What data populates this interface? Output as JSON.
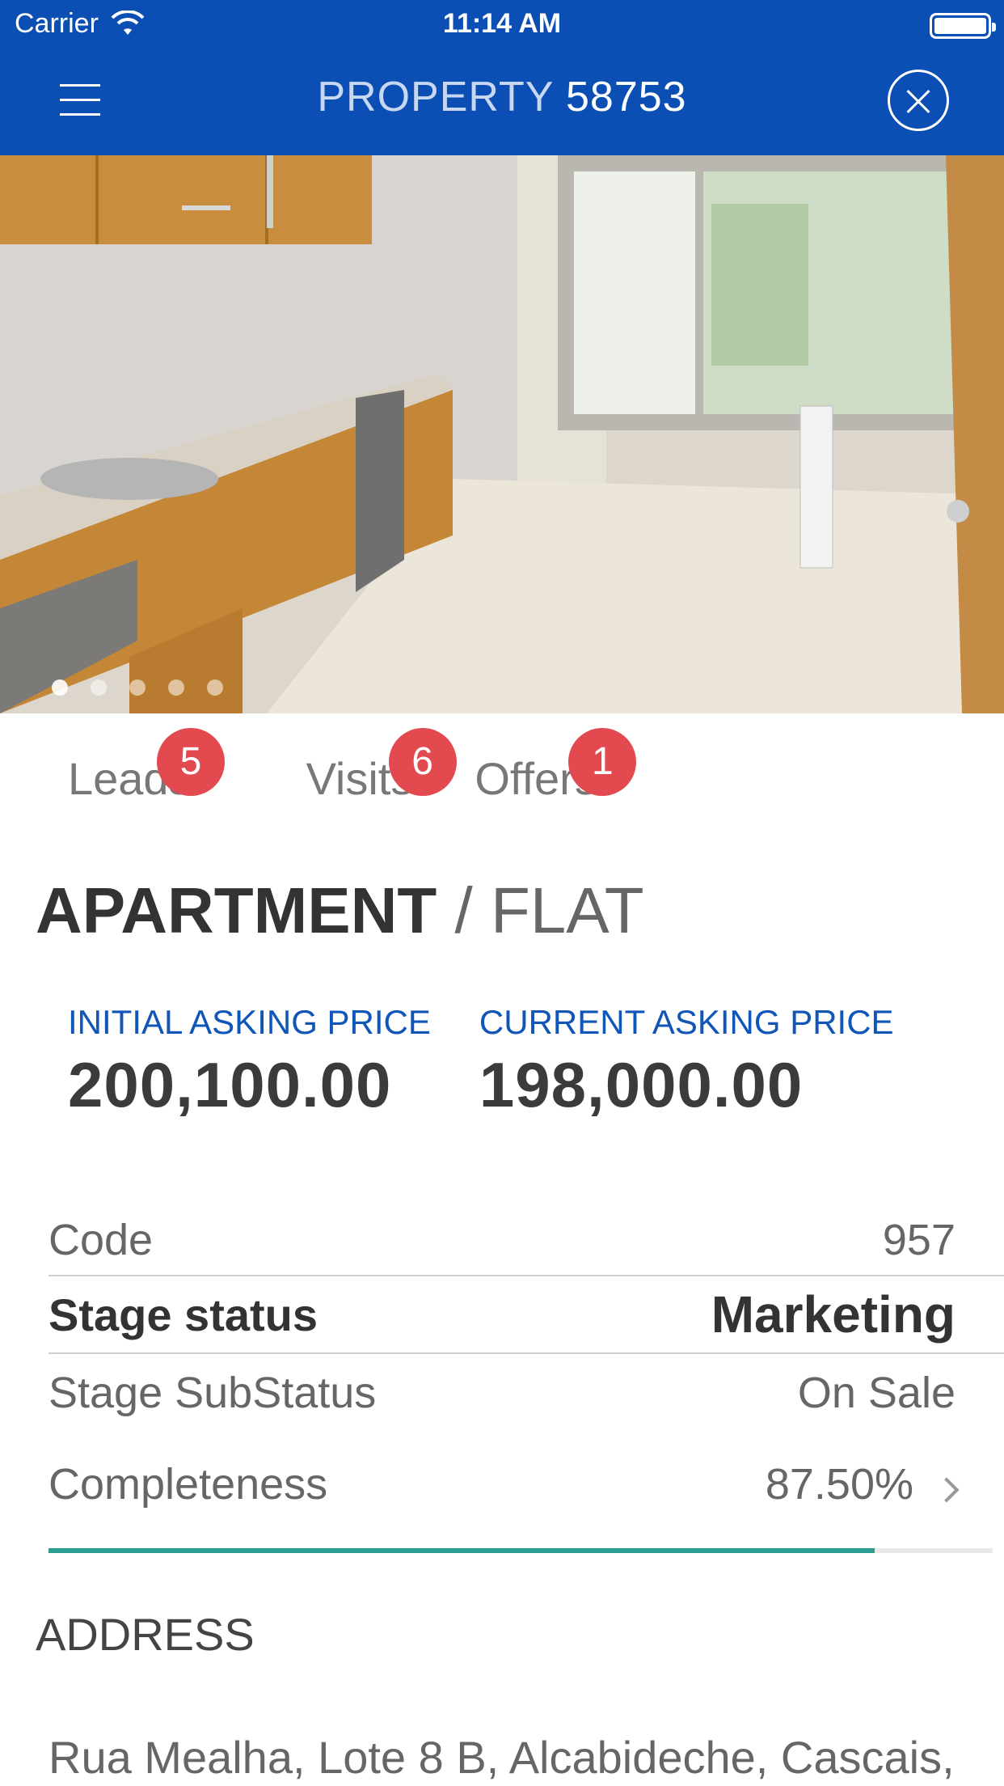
{
  "status_bar": {
    "carrier": "Carrier",
    "time": "11:14 AM"
  },
  "nav": {
    "title_prefix": "PROPERTY",
    "title_number": "58753",
    "menu_icon": "hamburger-icon",
    "close_icon": "close-circle-icon"
  },
  "gallery": {
    "photo_count": 5,
    "active_index": 0
  },
  "counters": [
    {
      "label": "Leads",
      "count": "5"
    },
    {
      "label": "Visits",
      "count": "6"
    },
    {
      "label": "Offers",
      "count": "1"
    }
  ],
  "property_type": {
    "main": "APARTMENT",
    "sub": "/ FLAT"
  },
  "prices": {
    "initial_label": "INITIAL ASKING PRICE",
    "initial_value": "200,100.00",
    "current_label": "CURRENT ASKING PRICE",
    "current_value": "198,000.00"
  },
  "details": {
    "code_label": "Code",
    "code_value": "957",
    "stage_label": "Stage status",
    "stage_value": "Marketing",
    "substatus_label": "Stage SubStatus",
    "substatus_value": "On Sale",
    "completeness_label": "Completeness",
    "completeness_value": "87.50%",
    "completeness_fraction": 0.875
  },
  "address": {
    "title": "ADDRESS",
    "text": "Rua Mealha, Lote 8 B, Alcabideche, Cascais,"
  },
  "colors": {
    "primary": "#0b4fb5",
    "badge": "#e24a4f",
    "progress": "#2a9d8f",
    "label_blue": "#1055b8"
  }
}
